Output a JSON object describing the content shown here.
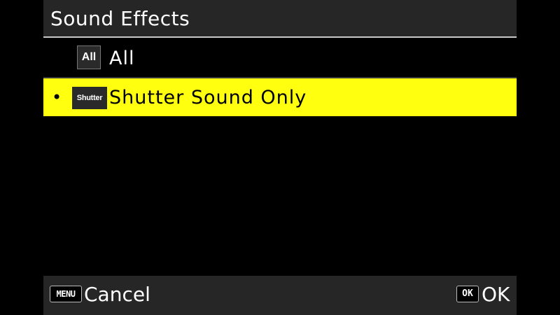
{
  "header": {
    "title": "Sound Effects"
  },
  "options": [
    {
      "icon": "All",
      "label": "All",
      "selected": false
    },
    {
      "icon": "Shutter",
      "label": "Shutter Sound Only",
      "selected": true,
      "bullet": "•"
    }
  ],
  "footer": {
    "cancel_key": "MENU",
    "cancel_label": "Cancel",
    "ok_key": "OK",
    "ok_label": "OK"
  },
  "colors": {
    "background": "#000000",
    "bar": "#262626",
    "highlight": "#ffff0f"
  }
}
